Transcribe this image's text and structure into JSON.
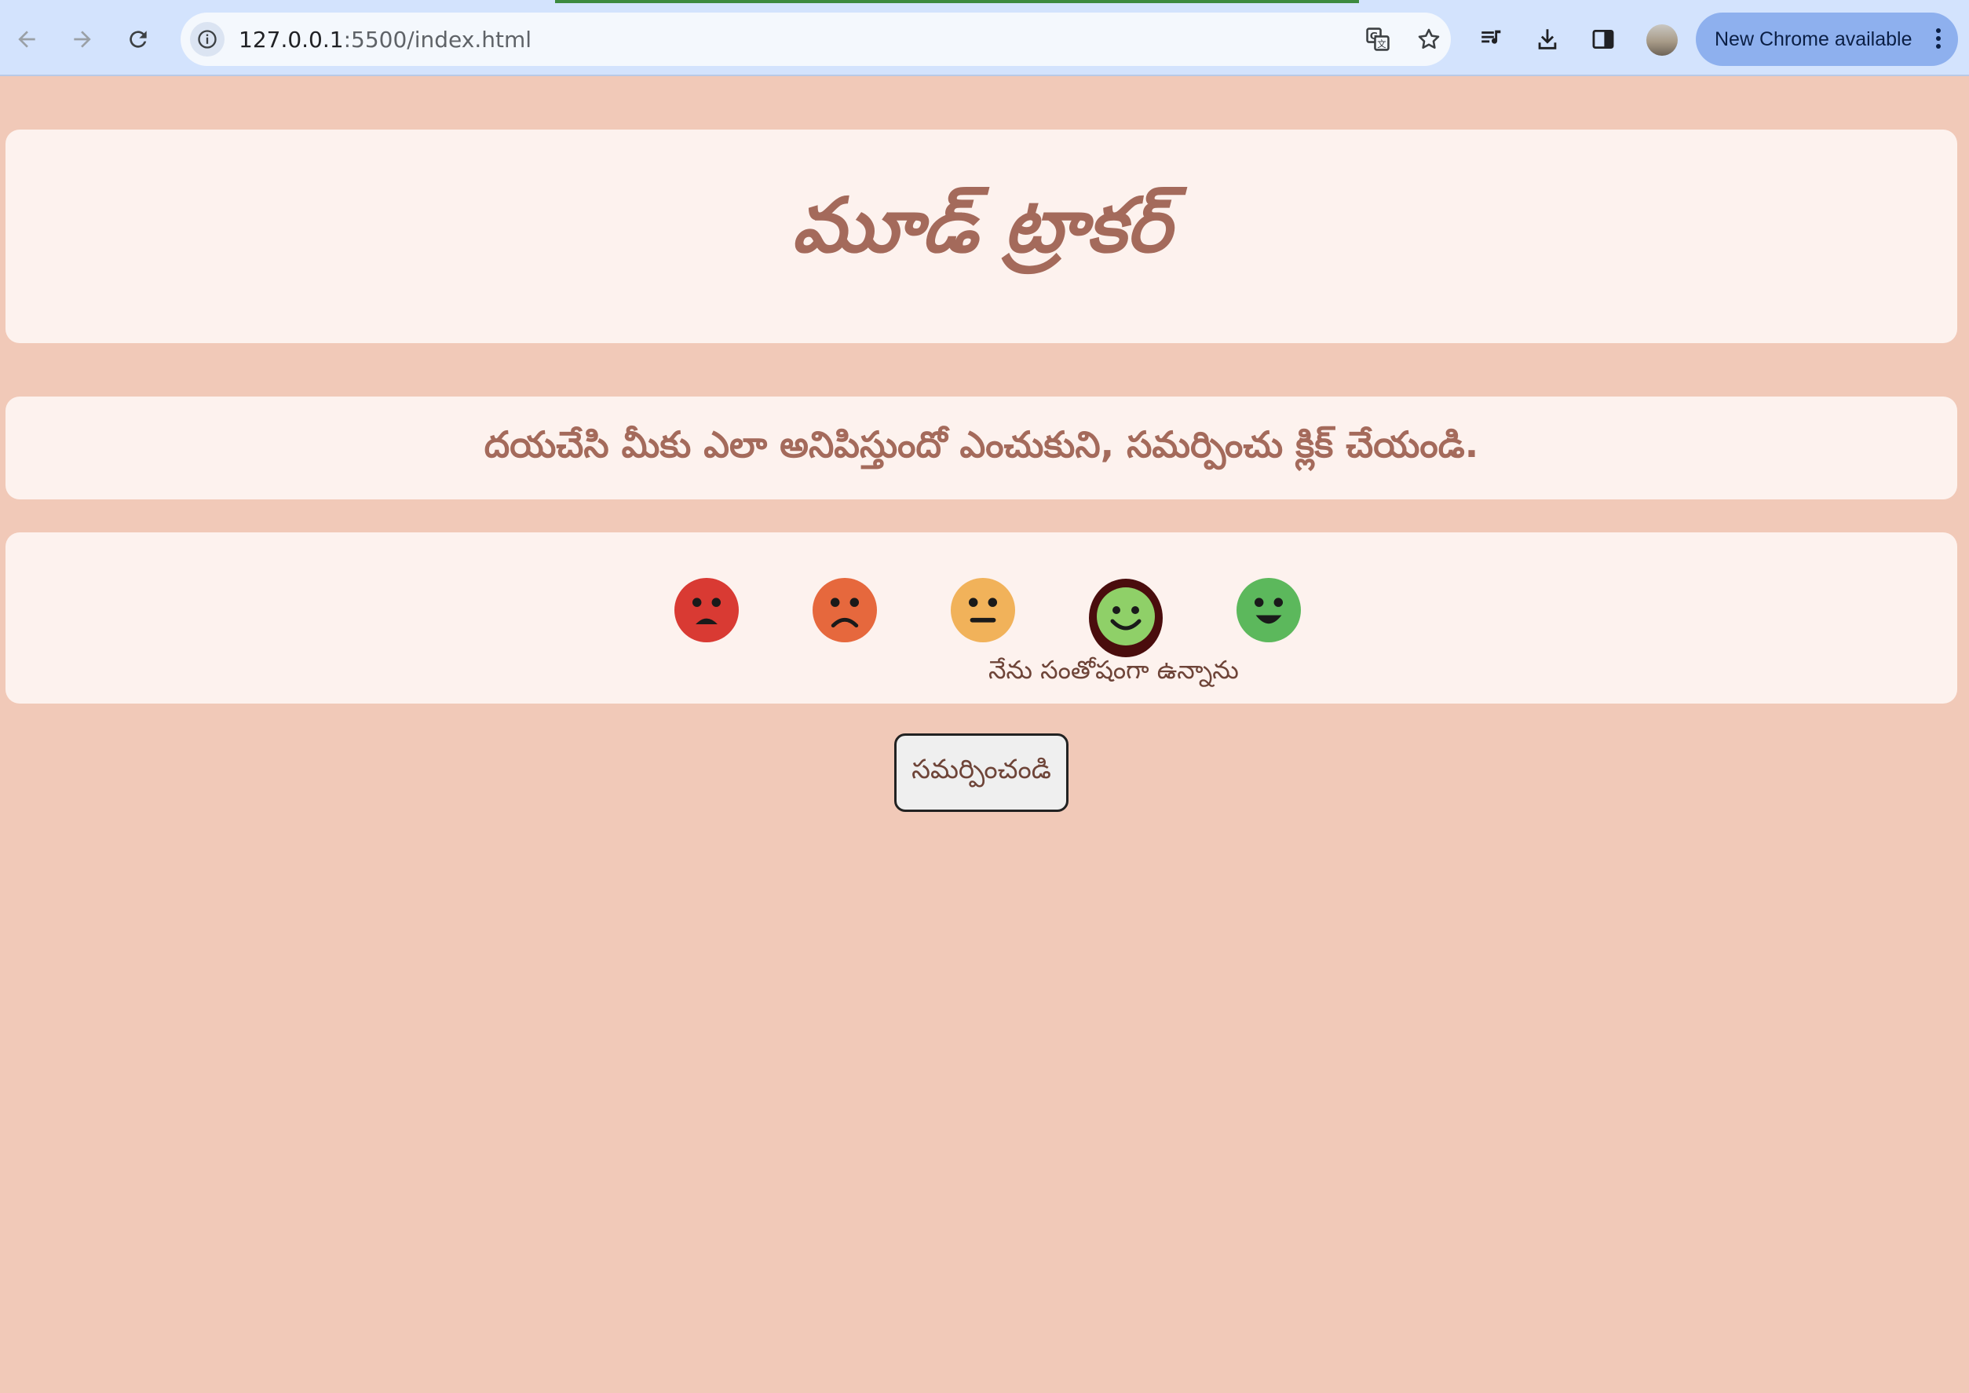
{
  "browser": {
    "url_host": "127.0.0.1",
    "url_path": ":5500/index.html",
    "update_button_label": "New Chrome available",
    "icons": [
      "back-icon",
      "forward-icon",
      "reload-icon",
      "site-info-icon",
      "translate-icon",
      "bookmark-star-icon",
      "media-controls-icon",
      "downloads-icon",
      "side-panel-icon",
      "profile-avatar",
      "more-menu-icon"
    ]
  },
  "page": {
    "title": "మూడ్ ట్రాకర్",
    "instruction": "దయచేసి మీకు ఎలా అనిపిస్తుందో ఎంచుకుని, సమర్పించు క్లిక్ చేయండి.",
    "selected_mood_label": "నేను సంతోషంగా ఉన్నాను",
    "submit_label": "సమర్పించండి"
  },
  "moods": [
    {
      "id": "very-sad",
      "color": "#d93a33",
      "selected": false
    },
    {
      "id": "sad",
      "color": "#e6683d",
      "selected": false
    },
    {
      "id": "neutral",
      "color": "#f1b25a",
      "selected": false
    },
    {
      "id": "happy",
      "color": "#8fd068",
      "selected": true
    },
    {
      "id": "very-happy",
      "color": "#5cb85c",
      "selected": false
    }
  ],
  "colors": {
    "background": "#f1c9b8",
    "card": "#fdf2ee",
    "heading": "#a46a5b",
    "selected_ring": "#4a0d0d"
  }
}
